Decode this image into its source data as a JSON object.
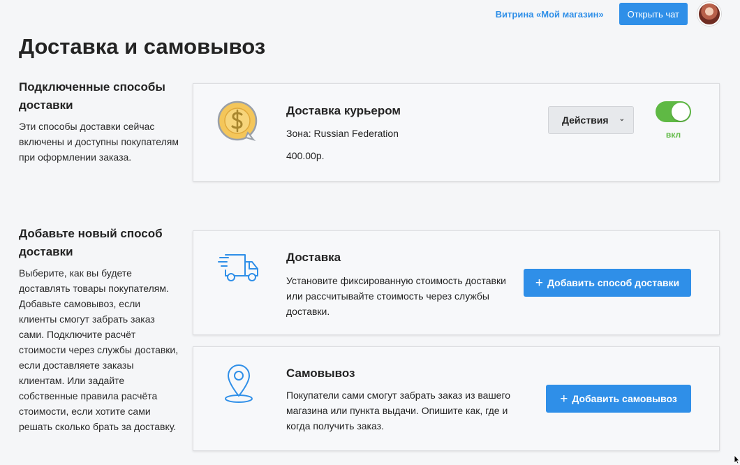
{
  "header": {
    "storefront_link": "Витрина «Мой магазин»",
    "chat_button": "Открыть чат"
  },
  "page_title": "Доставка и самовывоз",
  "connected": {
    "heading": "Подключенные способы доставки",
    "description": "Эти способы доставки сейчас включены и доступны покупателям при оформлении заказа.",
    "method": {
      "title": "Доставка курьером",
      "zone": "Зона: Russian Federation",
      "price": "400.00р.",
      "actions_button": "Действия",
      "toggle_label": "вкл",
      "enabled": true
    }
  },
  "add_new": {
    "heading": "Добавьте новый способ доставки",
    "description": "Выберите, как вы будете доставлять товары покупателям. Добавьте самовывоз, если клиенты смогут забрать заказ сами. Подключите расчёт стоимости через службы доставки, если доставляете заказы клиентам. Или задайте собственные правила расчёта стоимости, если хотите сами решать сколько брать за доставку.",
    "delivery": {
      "title": "Доставка",
      "description": "Установите фиксированную стоимость доставки или рассчитывайте стоимость через службы доставки.",
      "button": "Добавить способ доставки"
    },
    "pickup": {
      "title": "Самовывоз",
      "description": "Покупатели сами смогут забрать заказ из вашего магазина или пункта выдачи. Опишите как, где и когда получить заказ.",
      "button": "Добавить самовывоз"
    }
  },
  "colors": {
    "accent": "#2f8fe8",
    "toggle_on": "#5fb944",
    "background": "#f5f6f8"
  },
  "icons": {
    "courier": "coin-dollar-icon",
    "delivery": "truck-icon",
    "pickup": "map-pin-icon"
  }
}
